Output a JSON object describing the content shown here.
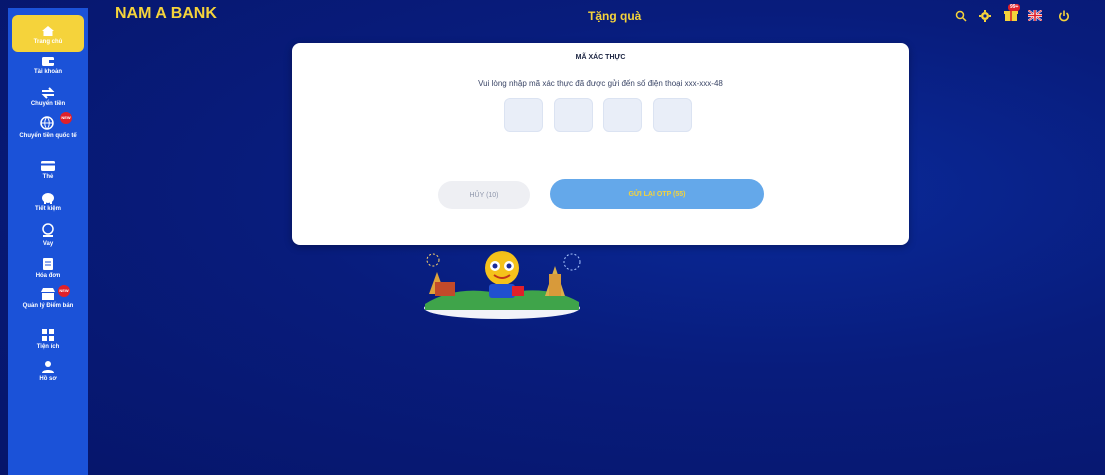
{
  "brand": "NAM A BANK",
  "page_title": "Tặng quà",
  "colors": {
    "accent_yellow": "#f5d33b",
    "sidebar_blue": "#1b52d8",
    "background_navy": "#081c7c",
    "badge_red": "#e0202a",
    "button_blue": "#64a8ea"
  },
  "sidebar": {
    "items": [
      {
        "label": "Trang chủ",
        "icon": "home-icon",
        "active": true
      },
      {
        "label": "Tài khoản",
        "icon": "wallet-icon"
      },
      {
        "label": "Chuyển tiền",
        "icon": "transfer-arrows-icon"
      },
      {
        "label": "Chuyển tiền quốc tế",
        "icon": "globe-money-icon",
        "badge": "NEW"
      },
      {
        "label": "Thẻ",
        "icon": "card-icon"
      },
      {
        "label": "Tiết kiệm",
        "icon": "piggy-bank-icon"
      },
      {
        "label": "Vay",
        "icon": "loan-icon"
      },
      {
        "label": "Hóa đơn",
        "icon": "bill-icon"
      },
      {
        "label": "Quản lý Điểm bán",
        "icon": "store-icon",
        "badge": "NEW"
      },
      {
        "label": "Tiện ích",
        "icon": "grid-icon"
      },
      {
        "label": "Hồ sơ",
        "icon": "profile-icon"
      }
    ]
  },
  "header_icons": {
    "search": "search-icon",
    "settings": "gear-icon",
    "gift": "gift-icon",
    "gift_badge": "99+",
    "language": "uk-flag-icon",
    "power": "power-icon"
  },
  "modal": {
    "title": "MÃ XÁC THỰC",
    "instruction": "Vui lòng nhập mã xác thực đã được gửi đến số điện thoại xxx-xxx-48",
    "otp_boxes": [
      "",
      "",
      "",
      ""
    ],
    "cancel_label": "HỦY (10)",
    "resend_label": "GỬI LẠI OTP (55)"
  }
}
